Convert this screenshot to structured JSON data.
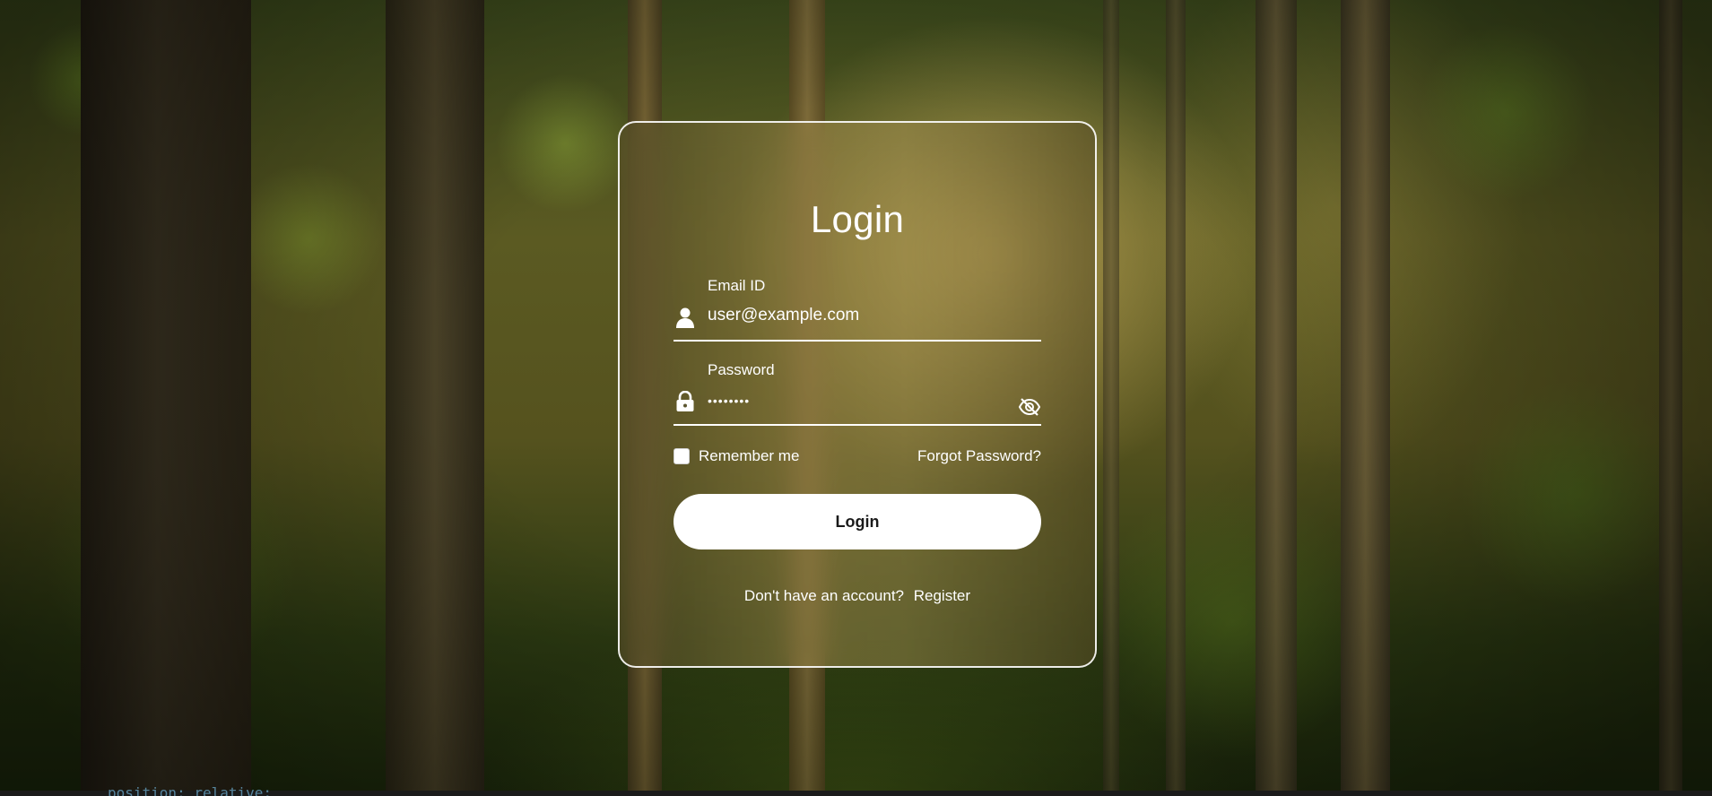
{
  "login": {
    "title": "Login",
    "email": {
      "label": "Email ID",
      "value": "user@example.com",
      "icon": "user-icon"
    },
    "password": {
      "label": "Password",
      "value": "••••••••",
      "icon": "lock-icon",
      "toggle_icon": "eye-off-icon"
    },
    "remember_label": "Remember me",
    "remember_checked": false,
    "forgot_label": "Forgot Password?",
    "submit_label": "Login",
    "register_prompt": "Don't have an account?",
    "register_label": "Register"
  },
  "background": {
    "code_peek": "position: relative;"
  },
  "colors": {
    "text": "#ffffff",
    "button_bg": "#ffffff",
    "button_text": "#1a1a1a",
    "card_border": "#ffffff"
  }
}
